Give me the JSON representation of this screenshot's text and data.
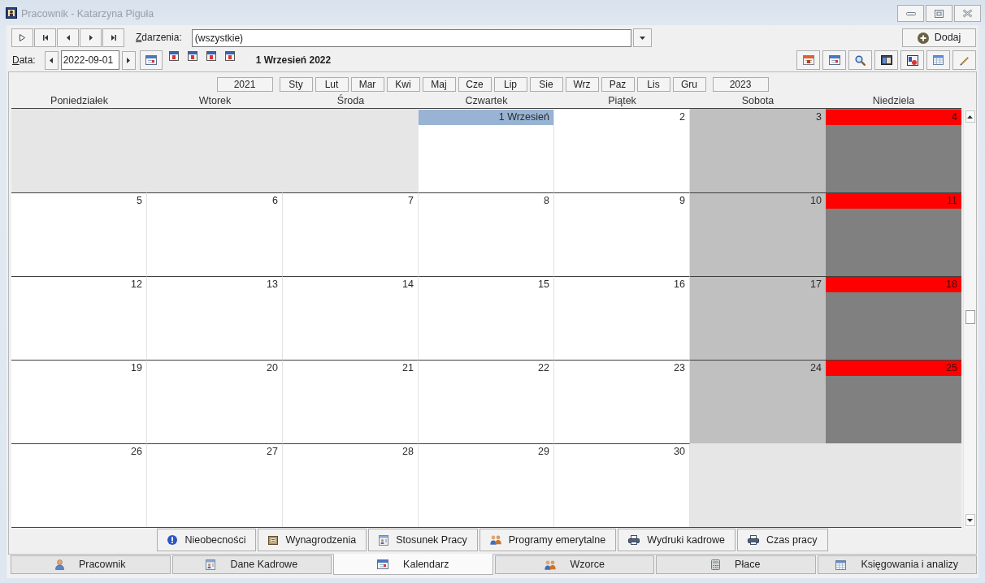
{
  "window": {
    "title": "Pracownik - Katarzyna Piguła"
  },
  "toolbar": {
    "events_label": "Zdarzenia:",
    "events_filter": "(wszystkie)",
    "add_button": "Dodaj",
    "date_label": "Data:",
    "date": "2022-09-01",
    "current_date": "1 Wrzesień 2022"
  },
  "calendar": {
    "previous_year": "2021",
    "months": [
      "Sty",
      "Lut",
      "Mar",
      "Kwi",
      "Maj",
      "Cze",
      "Lip",
      "Sie",
      "Wrz",
      "Paz",
      "Lis",
      "Gru"
    ],
    "next_year": "2023",
    "weekdays": [
      "Poniedziałek",
      "Wtorek",
      "Środa",
      "Czwartek",
      "Piątek",
      "Sobota",
      "Niedziela"
    ],
    "weeks": [
      [
        {
          "kind": "empty",
          "selected": false
        },
        {
          "kind": "empty",
          "selected": false
        },
        {
          "kind": "empty",
          "selected": false
        },
        {
          "kind": "workday",
          "day": "1 Wrzesień",
          "selected": true
        },
        {
          "kind": "workday",
          "day": "2",
          "selected": false
        },
        {
          "kind": "saturday",
          "day": "3",
          "selected": false
        },
        {
          "kind": "sunday",
          "day": "4",
          "selected": false
        }
      ],
      [
        {
          "kind": "workday",
          "day": "5",
          "selected": false
        },
        {
          "kind": "workday",
          "day": "6",
          "selected": false
        },
        {
          "kind": "workday",
          "day": "7",
          "selected": false
        },
        {
          "kind": "workday",
          "day": "8",
          "selected": false
        },
        {
          "kind": "workday",
          "day": "9",
          "selected": false
        },
        {
          "kind": "saturday",
          "day": "10",
          "selected": false
        },
        {
          "kind": "sunday",
          "day": "11",
          "selected": false
        }
      ],
      [
        {
          "kind": "workday",
          "day": "12",
          "selected": false
        },
        {
          "kind": "workday",
          "day": "13",
          "selected": false
        },
        {
          "kind": "workday",
          "day": "14",
          "selected": false
        },
        {
          "kind": "workday",
          "day": "15",
          "selected": false
        },
        {
          "kind": "workday",
          "day": "16",
          "selected": false
        },
        {
          "kind": "saturday",
          "day": "17",
          "selected": false
        },
        {
          "kind": "sunday",
          "day": "18",
          "selected": false
        }
      ],
      [
        {
          "kind": "workday",
          "day": "19",
          "selected": false
        },
        {
          "kind": "workday",
          "day": "20",
          "selected": false
        },
        {
          "kind": "workday",
          "day": "21",
          "selected": false
        },
        {
          "kind": "workday",
          "day": "22",
          "selected": false
        },
        {
          "kind": "workday",
          "day": "23",
          "selected": false
        },
        {
          "kind": "saturday",
          "day": "24",
          "selected": false
        },
        {
          "kind": "sunday",
          "day": "25",
          "selected": false
        }
      ],
      [
        {
          "kind": "workday",
          "day": "26",
          "selected": false
        },
        {
          "kind": "workday",
          "day": "27",
          "selected": false
        },
        {
          "kind": "workday",
          "day": "28",
          "selected": false
        },
        {
          "kind": "workday",
          "day": "29",
          "selected": false
        },
        {
          "kind": "workday",
          "day": "30",
          "selected": false
        },
        {
          "kind": "empty",
          "selected": false
        },
        {
          "kind": "empty",
          "selected": false
        }
      ]
    ]
  },
  "section_buttons": [
    "Nieobecności",
    "Wynagrodzenia",
    "Stosunek Pracy",
    "Programy emerytalne",
    "Wydruki kadrowe",
    "Czas pracy"
  ],
  "tabs": [
    {
      "label": "Pracownik",
      "selected": false
    },
    {
      "label": "Dane Kadrowe",
      "selected": false
    },
    {
      "label": "Kalendarz",
      "selected": true
    },
    {
      "label": "Wzorce",
      "selected": false
    },
    {
      "label": "Płace",
      "selected": false
    },
    {
      "label": "Księgowania i analizy",
      "selected": false
    }
  ]
}
